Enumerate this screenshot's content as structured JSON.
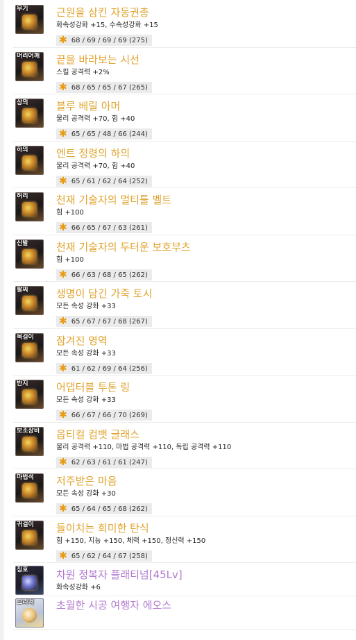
{
  "items": [
    {
      "slot": "무기",
      "name": "근원을 삼킨 자동권총",
      "stat": "화속성강화 +15, 수속성강화 +15",
      "score": "68 / 69 / 69 / 69 (275)"
    },
    {
      "slot": "머리어깨",
      "name": "끝을 바라보는 시선",
      "stat": "스킬 공격력 +2%",
      "score": "68 / 65 / 65 / 67 (265)"
    },
    {
      "slot": "상의",
      "name": "블루 베릴 아머",
      "stat": "물리 공격력 +70, 힘 +40",
      "score": "65 / 65 / 48 / 66 (244)"
    },
    {
      "slot": "하의",
      "name": "엔트 정령의 하의",
      "stat": "물리 공격력 +70, 힘 +40",
      "score": "65 / 61 / 62 / 64 (252)"
    },
    {
      "slot": "허리",
      "name": "천재 기술자의 멀티툴 벨트",
      "stat": "힘 +100",
      "score": "66 / 65 / 67 / 63 (261)"
    },
    {
      "slot": "신발",
      "name": "천재 기술자의 두터운 보호부츠",
      "stat": "힘 +100",
      "score": "66 / 63 / 68 / 65 (262)"
    },
    {
      "slot": "팔찌",
      "name": "생명이 담긴 가죽 토시",
      "stat": "모든 속성 강화 +33",
      "score": "65 / 67 / 67 / 68 (267)"
    },
    {
      "slot": "목걸이",
      "name": "잠겨진 영역",
      "stat": "모든 속성 강화 +33",
      "score": "61 / 62 / 69 / 64 (256)"
    },
    {
      "slot": "반지",
      "name": "어댑터블 투톤 링",
      "stat": "모든 속성 강화 +33",
      "score": "66 / 67 / 66 / 70 (269)"
    },
    {
      "slot": "보조장비",
      "name": "옵티컬 컴뱃 글래스",
      "stat": "물리 공격력 +110, 마법 공격력 +110, 독립 공격력 +110",
      "score": "62 / 63 / 61 / 61 (247)"
    },
    {
      "slot": "마법석",
      "name": "저주받은 마음",
      "stat": "모든 속성 강화 +30",
      "score": "65 / 64 / 65 / 68 (262)"
    },
    {
      "slot": "귀걸이",
      "name": "들이치는 희미한 탄식",
      "stat": "힘 +150, 지능 +150, 체력 +150, 정신력 +150",
      "score": "65 / 62 / 64 / 67 (258)"
    }
  ],
  "extra": [
    {
      "slot": "칭호",
      "name": "차원 정복자 플래티넘[45Lv]",
      "stat": "화속성강화 +6"
    },
    {
      "slot": "크리쳐",
      "name": "초월한 시공 여행자 에오스"
    }
  ],
  "star_glyph": "✱",
  "colors": {
    "legendary": "#e0a42f",
    "purple": "#b27ad0",
    "score_bg": "#ebebeb",
    "star": "#e89a12"
  }
}
